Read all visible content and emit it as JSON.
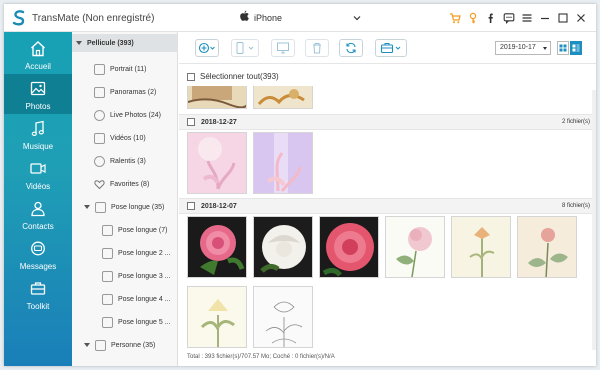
{
  "app": {
    "title": "TransMate (Non enregistré)",
    "device_name": "iPhone",
    "icons": [
      "cart-icon",
      "key-icon",
      "facebook-icon",
      "chat-icon",
      "menu-icon",
      "minimize-icon",
      "maximize-icon",
      "close-icon"
    ]
  },
  "sidebar": {
    "items": [
      {
        "label": "Accueil",
        "icon": "home-icon",
        "active": false
      },
      {
        "label": "Photos",
        "icon": "photo-icon",
        "active": true
      },
      {
        "label": "Musique",
        "icon": "music-icon",
        "active": false
      },
      {
        "label": "Vidéos",
        "icon": "video-icon",
        "active": false
      },
      {
        "label": "Contacts",
        "icon": "contacts-icon",
        "active": false
      },
      {
        "label": "Messages",
        "icon": "messages-icon",
        "active": false
      },
      {
        "label": "Toolkit",
        "icon": "toolkit-icon",
        "active": false
      }
    ]
  },
  "tree": {
    "root": "Pellicule (393)",
    "items": [
      {
        "label": "Portrait (11)"
      },
      {
        "label": "Panoramas (2)"
      },
      {
        "label": "Live Photos (24)"
      },
      {
        "label": "Vidéos (10)"
      },
      {
        "label": "Ralentis (3)"
      },
      {
        "label": "Favorites (8)"
      }
    ],
    "group": "Pose longue (35)",
    "subitems": [
      {
        "label": "Pose longue (7)"
      },
      {
        "label": "Pose longue 2 ..."
      },
      {
        "label": "Pose longue 3 ..."
      },
      {
        "label": "Pose longue 4 ..."
      },
      {
        "label": "Pose longue 5 ..."
      }
    ],
    "last": "Personne (35)"
  },
  "toolbar": {
    "date_value": "2019-10-17"
  },
  "main": {
    "select_all": "Sélectionner tout(393)",
    "sections": [
      {
        "date": "2018-12-27",
        "count": "2 fichier(s)"
      },
      {
        "date": "2018-12-07",
        "count": "8 fichier(s)"
      }
    ],
    "status": "Total : 393 fichier(s)/707.57 Mo; Coché : 0 fichier(s)/N/A"
  },
  "colors": {
    "sidebar_top": "#17a1b4",
    "sidebar_active": "#0f7f94",
    "accent": "#1c8fc0"
  }
}
